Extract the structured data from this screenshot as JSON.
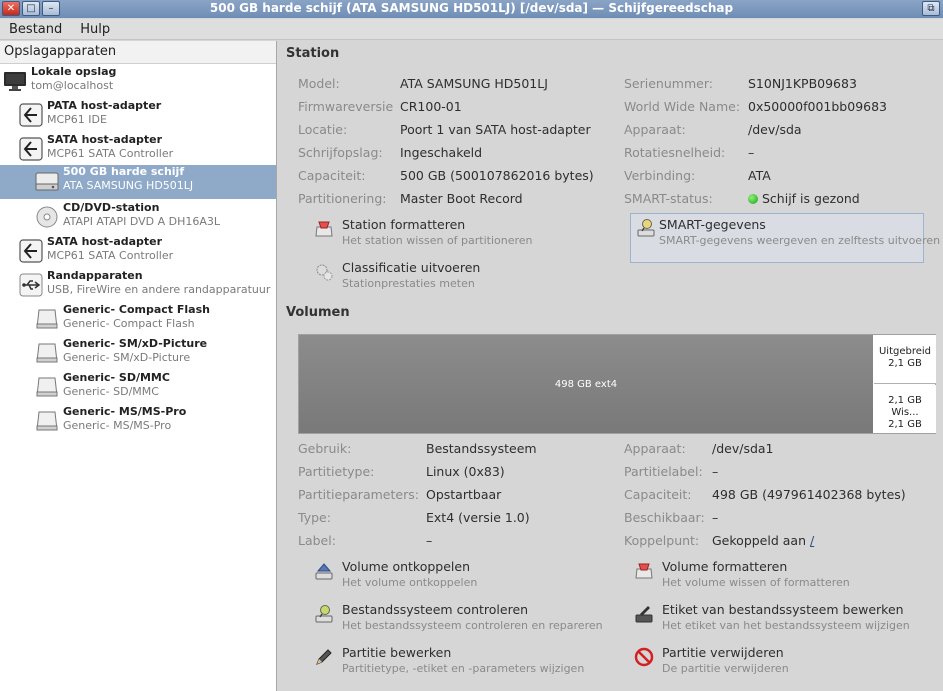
{
  "window": {
    "title": "500 GB harde schijf (ATA SAMSUNG HD501LJ) [/dev/sda] — Schijfgereedschap"
  },
  "menu": {
    "file": "Bestand",
    "help": "Hulp"
  },
  "sidebar": {
    "header": "Opslagapparaten",
    "items": [
      {
        "name": "Lokale opslag",
        "sub": "tom@localhost",
        "icon": "monitor-icon"
      },
      {
        "name": "PATA host-adapter",
        "sub": "MCP61 IDE",
        "icon": "adapter-icon"
      },
      {
        "name": "SATA host-adapter",
        "sub": "MCP61 SATA Controller",
        "icon": "adapter-icon"
      },
      {
        "name": "500 GB harde schijf",
        "sub": "ATA SAMSUNG HD501LJ",
        "icon": "harddisk-icon",
        "selected": true
      },
      {
        "name": "CD/DVD-station",
        "sub": "ATAPI ATAPI   DVD A  DH16A3L",
        "icon": "optical-drive-icon"
      },
      {
        "name": "SATA host-adapter",
        "sub": "MCP61 SATA Controller",
        "icon": "adapter-icon"
      },
      {
        "name": "Randapparaten",
        "sub": "USB, FireWire en andere randapparatuur",
        "icon": "usb-icon"
      },
      {
        "name": "Generic- Compact Flash",
        "sub": "Generic- Compact Flash",
        "icon": "card-reader-icon"
      },
      {
        "name": "Generic- SM/xD-Picture",
        "sub": "Generic- SM/xD-Picture",
        "icon": "card-reader-icon"
      },
      {
        "name": "Generic- SD/MMC",
        "sub": "Generic- SD/MMC",
        "icon": "card-reader-icon"
      },
      {
        "name": "Generic- MS/MS-Pro",
        "sub": "Generic- MS/MS-Pro",
        "icon": "card-reader-icon"
      }
    ]
  },
  "station": {
    "title": "Station",
    "left": [
      {
        "label": "Model:",
        "value": "ATA SAMSUNG HD501LJ"
      },
      {
        "label": "Firmwareversie",
        "value": "CR100-01"
      },
      {
        "label": "Locatie:",
        "value": "Poort 1 van SATA host-adapter"
      },
      {
        "label": "Schrijfopslag:",
        "value": "Ingeschakeld"
      },
      {
        "label": "Capaciteit:",
        "value": "500 GB (500107862016 bytes)"
      },
      {
        "label": "Partitionering:",
        "value": "Master Boot Record"
      }
    ],
    "right": [
      {
        "label": "Serienummer:",
        "value": "S10NJ1KPB09683"
      },
      {
        "label": "World Wide Name:",
        "value": "0x50000f001bb09683"
      },
      {
        "label": "Apparaat:",
        "value": "/dev/sda"
      },
      {
        "label": "Rotatiesnelheid:",
        "value": "–"
      },
      {
        "label": "Verbinding:",
        "value": "ATA"
      },
      {
        "label": "SMART-status:",
        "value": "Schijf is gezond"
      }
    ],
    "actions": {
      "format": {
        "name": "Station formatteren",
        "desc": "Het station wissen of partitioneren"
      },
      "smart": {
        "name": "SMART-gegevens",
        "desc": "SMART-gegevens weergeven en zelftests uitvoeren"
      },
      "benchmark": {
        "name": "Classificatie uitvoeren",
        "desc": "Stationprestaties meten"
      }
    },
    "colors": {
      "smart_ok": "#18a312"
    }
  },
  "volume": {
    "title": "Volumen",
    "partitions": {
      "main": "498 GB ext4",
      "extended_name": "Uitgebreid",
      "extended_size": "2,1 GB",
      "swap_name": "2,1 GB Wis...",
      "swap_size": "2,1 GB"
    },
    "left": [
      {
        "label": "Gebruik:",
        "value": "Bestandssysteem"
      },
      {
        "label": "Partitietype:",
        "value": "Linux (0x83)"
      },
      {
        "label": "Partitieparameters:",
        "value": "Opstartbaar"
      },
      {
        "label": "Type:",
        "value": "Ext4 (versie 1.0)"
      },
      {
        "label": "Label:",
        "value": "–"
      }
    ],
    "right": [
      {
        "label": "Apparaat:",
        "value": "/dev/sda1"
      },
      {
        "label": "Partitielabel:",
        "value": "–"
      },
      {
        "label": "Capaciteit:",
        "value": "498 GB (497961402368 bytes)"
      },
      {
        "label": "Beschikbaar:",
        "value": "–"
      },
      {
        "label": "Koppelpunt:",
        "value": "Gekoppeld aan",
        "link": "/"
      }
    ],
    "actions": {
      "unmount": {
        "name": "Volume ontkoppelen",
        "desc": "Het volume ontkoppelen"
      },
      "format": {
        "name": "Volume formatteren",
        "desc": "Het volume wissen of formatteren"
      },
      "check": {
        "name": "Bestandssysteem controleren",
        "desc": "Het bestandssysteem controleren en repareren"
      },
      "edit_label": {
        "name": "Etiket van bestandssysteem bewerken",
        "desc": "Het etiket van het bestandssysteem wijzigen"
      },
      "edit_partition": {
        "name": "Partitie bewerken",
        "desc": "Partitietype, -etiket en -parameters wijzigen"
      },
      "delete_partition": {
        "name": "Partitie verwijderen",
        "desc": "De partitie verwijderen"
      }
    }
  }
}
